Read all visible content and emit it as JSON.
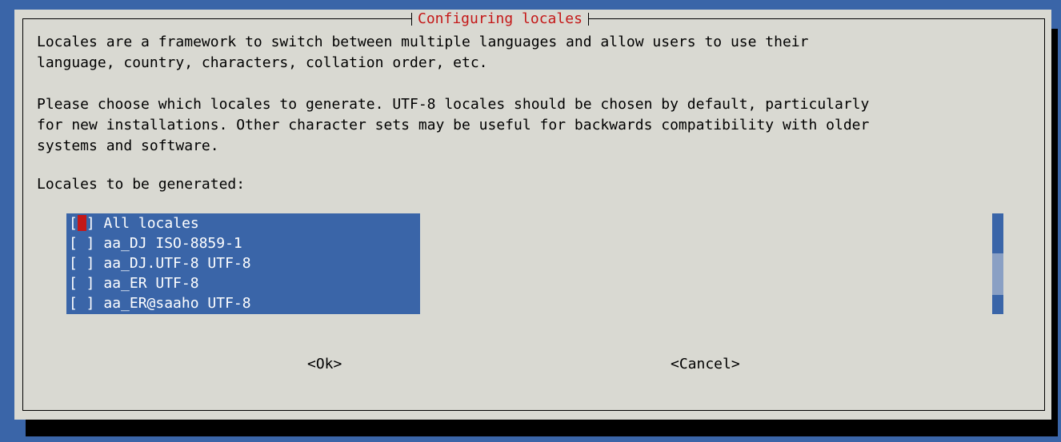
{
  "dialog": {
    "title": "Configuring locales",
    "description_lines": [
      "Locales are a framework to switch between multiple languages and allow users to use their",
      "language, country, characters, collation order, etc."
    ],
    "instruction_lines": [
      "Please choose which locales to generate. UTF-8 locales should be chosen by default, particularly",
      "for new installations. Other character sets may be useful for backwards compatibility with older",
      "systems and software."
    ],
    "list_label": "Locales to be generated:",
    "list_items": [
      {
        "checkbox": "[ ]",
        "label": "All locales"
      },
      {
        "checkbox": "[ ]",
        "label": "aa_DJ ISO-8859-1"
      },
      {
        "checkbox": "[ ]",
        "label": "aa_DJ.UTF-8 UTF-8"
      },
      {
        "checkbox": "[ ]",
        "label": "aa_ER UTF-8"
      },
      {
        "checkbox": "[ ]",
        "label": "aa_ER@saaho UTF-8"
      }
    ],
    "ok_button": "<Ok>",
    "cancel_button": "<Cancel>"
  },
  "colors": {
    "background": "#3a65a8",
    "dialog": "#d9d9d2",
    "title_text": "#c41818",
    "selection": "#3a65a8",
    "cursor": "#c41818"
  }
}
